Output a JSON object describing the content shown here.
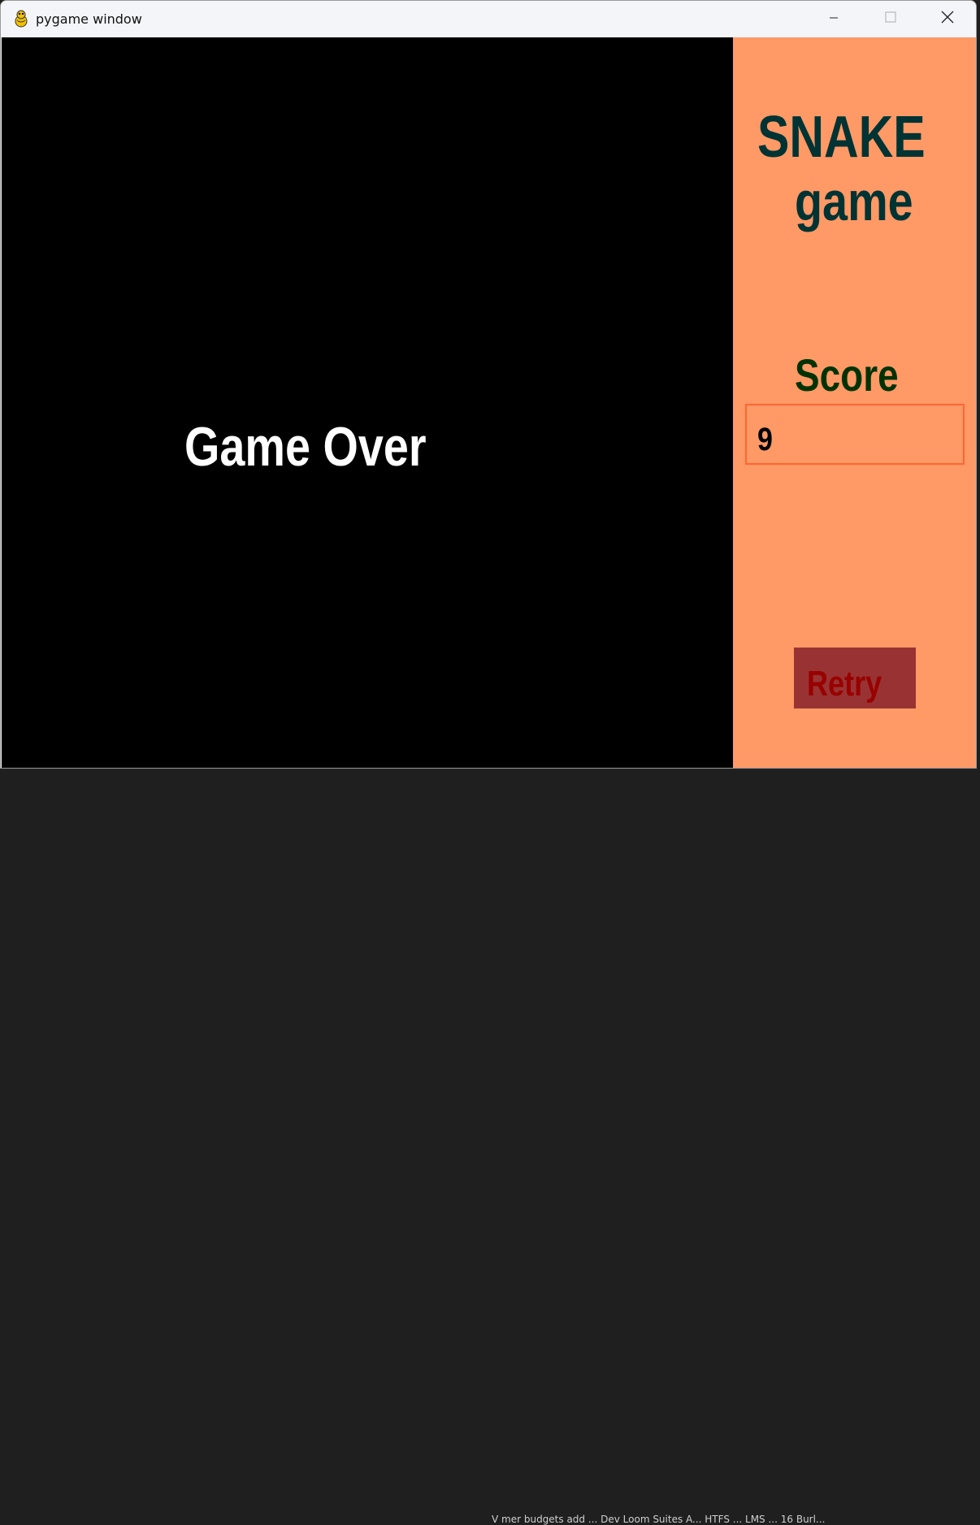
{
  "window": {
    "title": "pygame window"
  },
  "background_text": "V  mer   budgets add  ... Dev Loom    Suites A...   HTFS   ... LMS   ... 16  Burl...",
  "game": {
    "message": "Game Over"
  },
  "sidebar": {
    "title_line1": "SNAKE",
    "title_line2": "game",
    "score_label": "Score",
    "score_value": "9",
    "retry_label": "Retry"
  },
  "colors": {
    "game_bg": "#000000",
    "sidebar_bg": "#ff9966",
    "title": "#003333",
    "score_label": "#003300",
    "score_box_border": "#ff6633",
    "retry_bg": "#993333",
    "retry_text": "#990000"
  },
  "icons": {
    "app": "pygame-snake-icon",
    "minimize": "minimize-icon",
    "maximize": "maximize-icon",
    "close": "close-icon"
  }
}
